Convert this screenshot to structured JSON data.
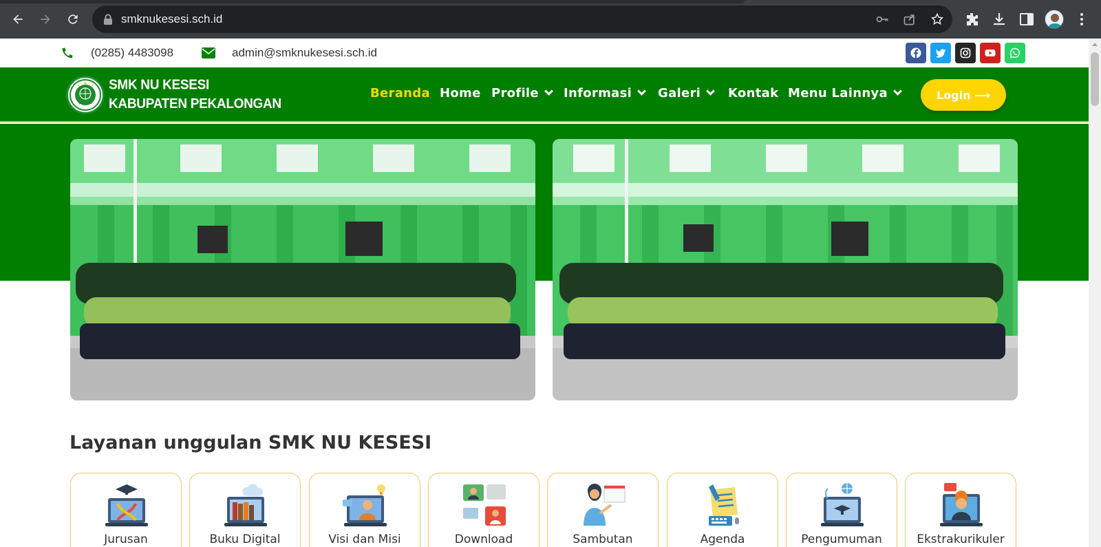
{
  "browser": {
    "url": "smknukesesi.sch.id"
  },
  "topbar": {
    "phone": "(0285) 4483098",
    "email": "admin@smknukesesi.sch.id",
    "social_colors": {
      "facebook": "#3b5998",
      "twitter": "#1da1f2",
      "instagram": "#262626",
      "youtube": "#cd201f",
      "whatsapp": "#25d366"
    }
  },
  "navbar": {
    "logo_line1": "SMK NU KESESI",
    "logo_line2": "KABUPATEN PEKALONGAN",
    "items": [
      {
        "label": "Beranda",
        "active": true
      },
      {
        "label": "Home"
      },
      {
        "label": "Profile"
      },
      {
        "label": "Informasi"
      },
      {
        "label": "Galeri"
      },
      {
        "label": "Kontak"
      },
      {
        "label": "Menu Lainnya"
      }
    ],
    "login_label": "Login ⟶",
    "bg_color": "#007e00",
    "active_color": "#f4d90a",
    "login_color": "#ffd500"
  },
  "section": {
    "title": "Layanan unggulan SMK NU KESESI",
    "cards": [
      {
        "label": "Jurusan",
        "icon": "graduation-laptop-icon"
      },
      {
        "label": "Buku Digital",
        "icon": "digital-books-icon"
      },
      {
        "label": "Visi dan Misi",
        "icon": "vision-mission-icon"
      },
      {
        "label": "Download",
        "icon": "download-chat-icon"
      },
      {
        "label": "Sambutan",
        "icon": "presenter-icon"
      },
      {
        "label": "Agenda",
        "icon": "agenda-icon"
      },
      {
        "label": "Pengumuman",
        "icon": "announcement-icon"
      },
      {
        "label": "Ekstrakurikuler",
        "icon": "extracurricular-icon"
      }
    ]
  }
}
